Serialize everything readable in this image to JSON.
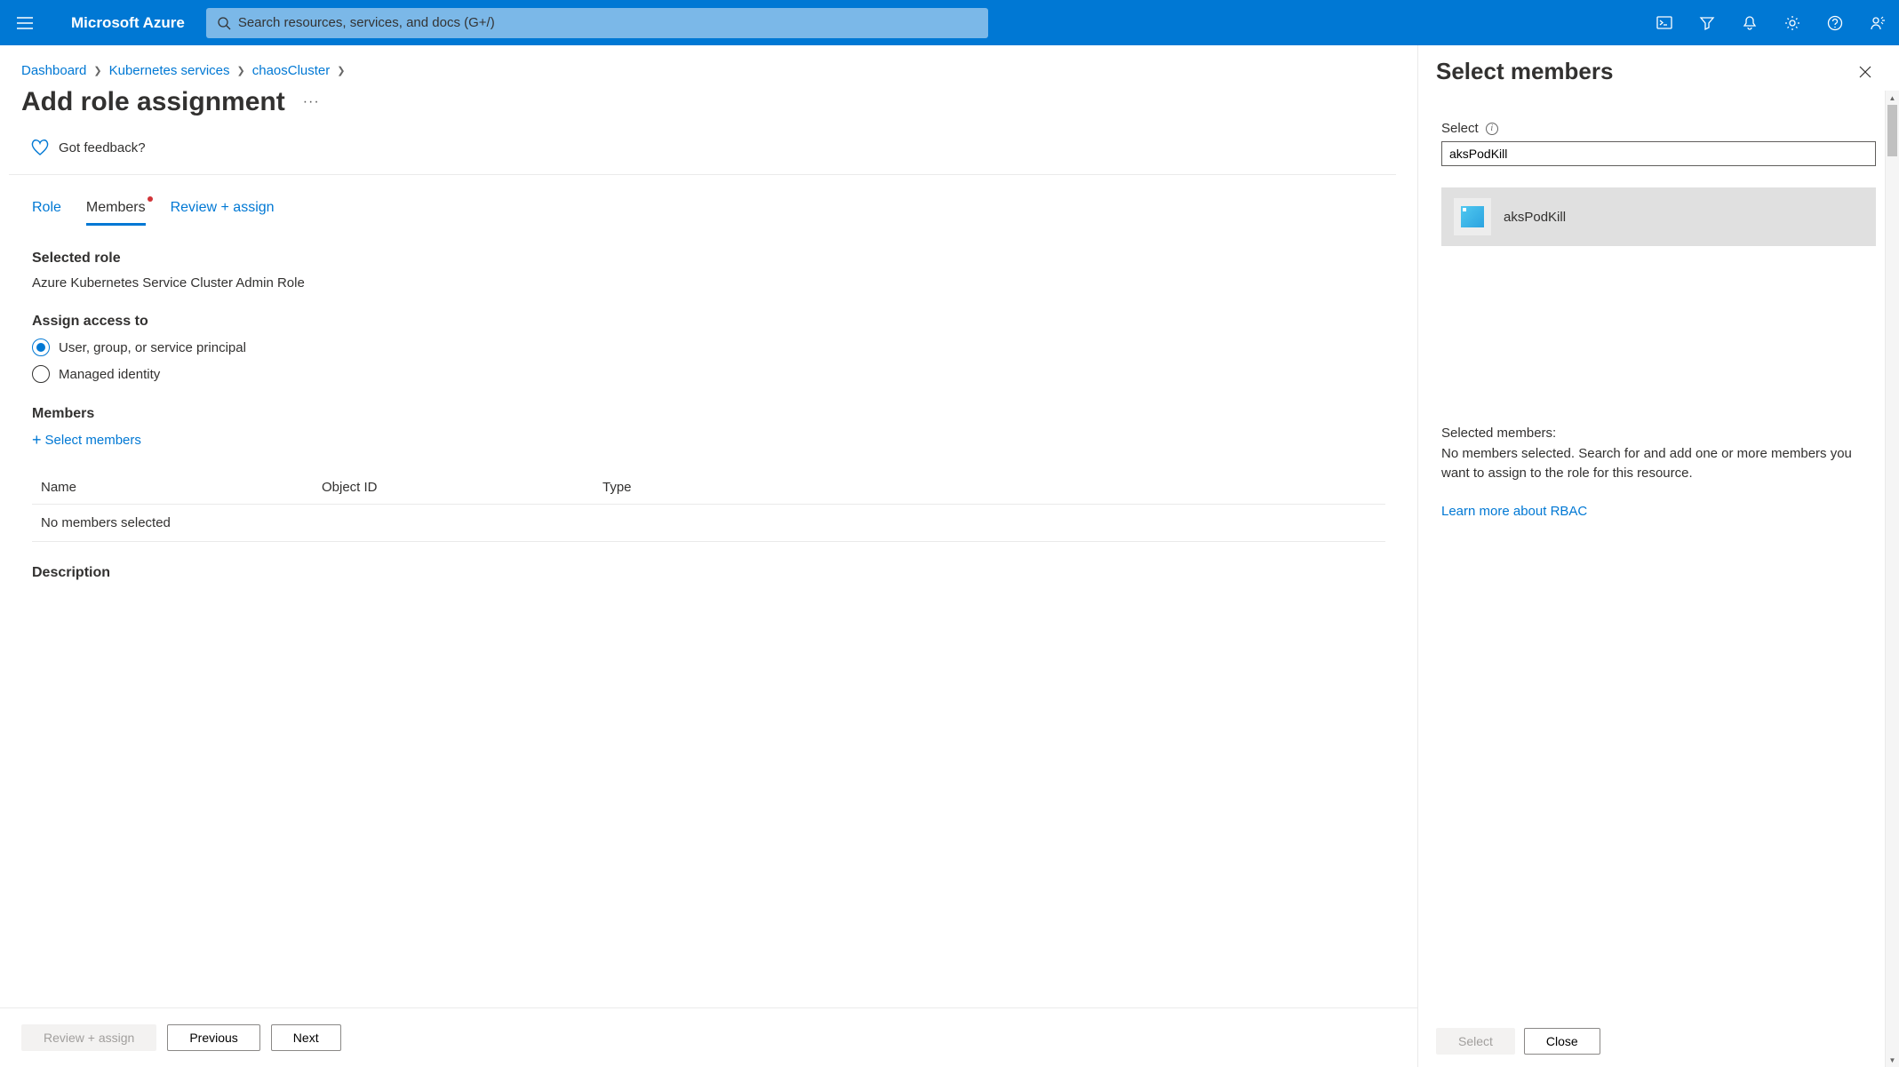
{
  "topbar": {
    "brand": "Microsoft Azure",
    "search_placeholder": "Search resources, services, and docs (G+/)"
  },
  "breadcrumb": [
    "Dashboard",
    "Kubernetes services",
    "chaosCluster"
  ],
  "page": {
    "title": "Add role assignment",
    "feedback": "Got feedback?"
  },
  "tabs": {
    "role": "Role",
    "members": "Members",
    "review": "Review + assign"
  },
  "sections": {
    "selected_role_label": "Selected role",
    "selected_role_value": "Azure Kubernetes Service Cluster Admin Role",
    "assign_access_label": "Assign access to",
    "radio_user": "User, group, or service principal",
    "radio_managed": "Managed identity",
    "members_label": "Members",
    "select_members_link": "Select members",
    "description_label": "Description"
  },
  "members_table": {
    "col_name": "Name",
    "col_object_id": "Object ID",
    "col_type": "Type",
    "empty_text": "No members selected"
  },
  "footer": {
    "review": "Review + assign",
    "previous": "Previous",
    "next": "Next"
  },
  "panel": {
    "title": "Select members",
    "select_label": "Select",
    "select_value": "aksPodKill",
    "result_name": "aksPodKill",
    "selected_members_label": "Selected members:",
    "selected_members_text": "No members selected. Search for and add one or more members you want to assign to the role for this resource.",
    "learn_more": "Learn more about RBAC",
    "btn_select": "Select",
    "btn_close": "Close"
  }
}
